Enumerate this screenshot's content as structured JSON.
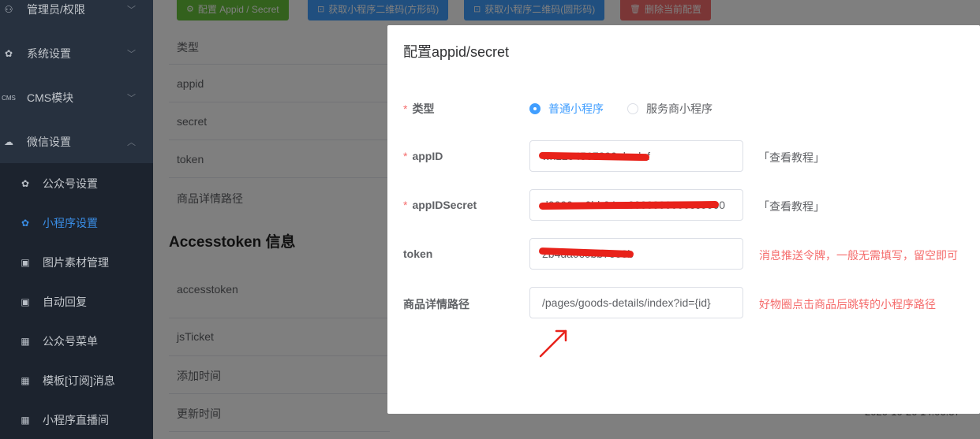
{
  "sidebar": {
    "menus": [
      {
        "label": "管理员/权限",
        "icon": "admin-icon",
        "glyph": "⚇"
      },
      {
        "label": "系统设置",
        "icon": "gear-icon",
        "glyph": "✿"
      },
      {
        "label": "CMS模块",
        "icon": "cms-icon",
        "glyph": "CMS"
      },
      {
        "label": "微信设置",
        "icon": "wechat-icon",
        "glyph": "☁"
      }
    ],
    "sub_items": [
      {
        "label": "公众号设置",
        "icon": "gear-icon",
        "glyph": "✿"
      },
      {
        "label": "小程序设置",
        "icon": "gear-icon",
        "glyph": "✿"
      },
      {
        "label": "图片素材管理",
        "icon": "image-icon",
        "glyph": "▣"
      },
      {
        "label": "自动回复",
        "icon": "reply-icon",
        "glyph": "▣"
      },
      {
        "label": "公众号菜单",
        "icon": "grid-icon",
        "glyph": "▦"
      },
      {
        "label": "模板[订阅]消息",
        "icon": "grid-icon",
        "glyph": "▦"
      },
      {
        "label": "小程序直播间",
        "icon": "grid-icon",
        "glyph": "▦"
      }
    ],
    "active_sub": "小程序设置"
  },
  "toolbar": {
    "config_btn": "配置 Appid / Secret",
    "qr_square_btn": "获取小程序二维码(方形码)",
    "qr_round_btn": "获取小程序二维码(圆形码)",
    "delete_btn": "删除当前配置",
    "colors": {
      "green": "#67c23a",
      "blue": "#409eff",
      "red": "#f56c6c"
    }
  },
  "background": {
    "rows": [
      "类型",
      "appid",
      "secret",
      "token",
      "商品详情路径"
    ],
    "section_title": "Accesstoken 信息",
    "token_rows": [
      "accesstoken",
      "jsTicket",
      "添加时间",
      "更新时间"
    ],
    "partial_date": "2020-10-20 14:06:37"
  },
  "dialog": {
    "title": "配置appid/secret",
    "type_label": "类型",
    "type_options": [
      "普通小程序",
      "服务商小程序"
    ],
    "type_selected": "普通小程序",
    "appid_label": "appID",
    "appid_value": "wx1234567890abcdef",
    "appid_help": "「查看教程」",
    "secret_label": "appIDSecret",
    "secret_value": "d0000aa0bb04aa0000000000cc0000",
    "secret_help": "「查看教程」",
    "token_label": "token",
    "token_value": "2b4da0c0bb7ee8b",
    "token_hint": "消息推送令牌，一般无需填写，留空即可",
    "path_label": "商品详情路径",
    "path_value": "/pages/goods-details/index?id={id}",
    "path_hint": "好物圈点击商品后跳转的小程序路径",
    "colors": {
      "required": "#f56c6c",
      "hint": "#f56c6c",
      "primary": "#409eff",
      "annotation": "#e8221a"
    }
  }
}
